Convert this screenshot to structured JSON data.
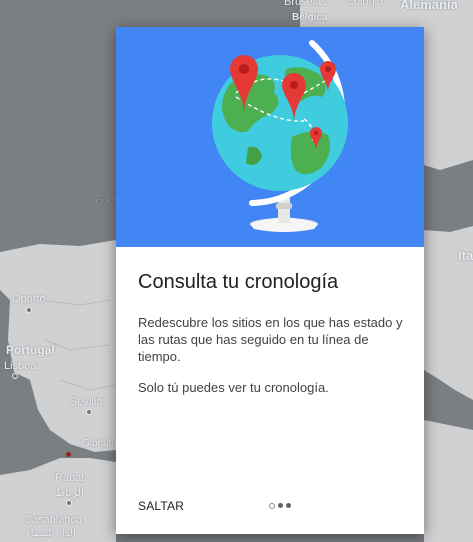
{
  "map": {
    "labels": {
      "bruselas": "Bruselas",
      "colonia": "Colonia",
      "belgica": "Bélgica",
      "alemania": "Alemania",
      "oporto": "Oporto",
      "portugal": "Portugal",
      "lisboa": "Lisboa",
      "sevilla": "Sevilla",
      "gibraltar": "Gibralta",
      "rabat": "Rabat",
      "rabat_ar": "الرباط",
      "casablanca": "Casablanca",
      "casablanca_ar": "الدار البيضاء",
      "ita": "Ita",
      "golfo": "Golfo"
    },
    "colors": {
      "land": "#cfd1d3",
      "water": "#7c7f82"
    }
  },
  "dialog": {
    "title": "Consulta tu cronología",
    "description": "Redescubre los sitios en los que has estado y las rutas que has seguido en tu línea de tiempo.",
    "privacy_note": "Solo tú puedes ver tu cronología.",
    "skip_label": "SALTAR",
    "pager": {
      "total": 3,
      "current": 1
    },
    "hero": {
      "illustration": "globe-with-location-pins",
      "background_color": "#4285f4"
    }
  }
}
